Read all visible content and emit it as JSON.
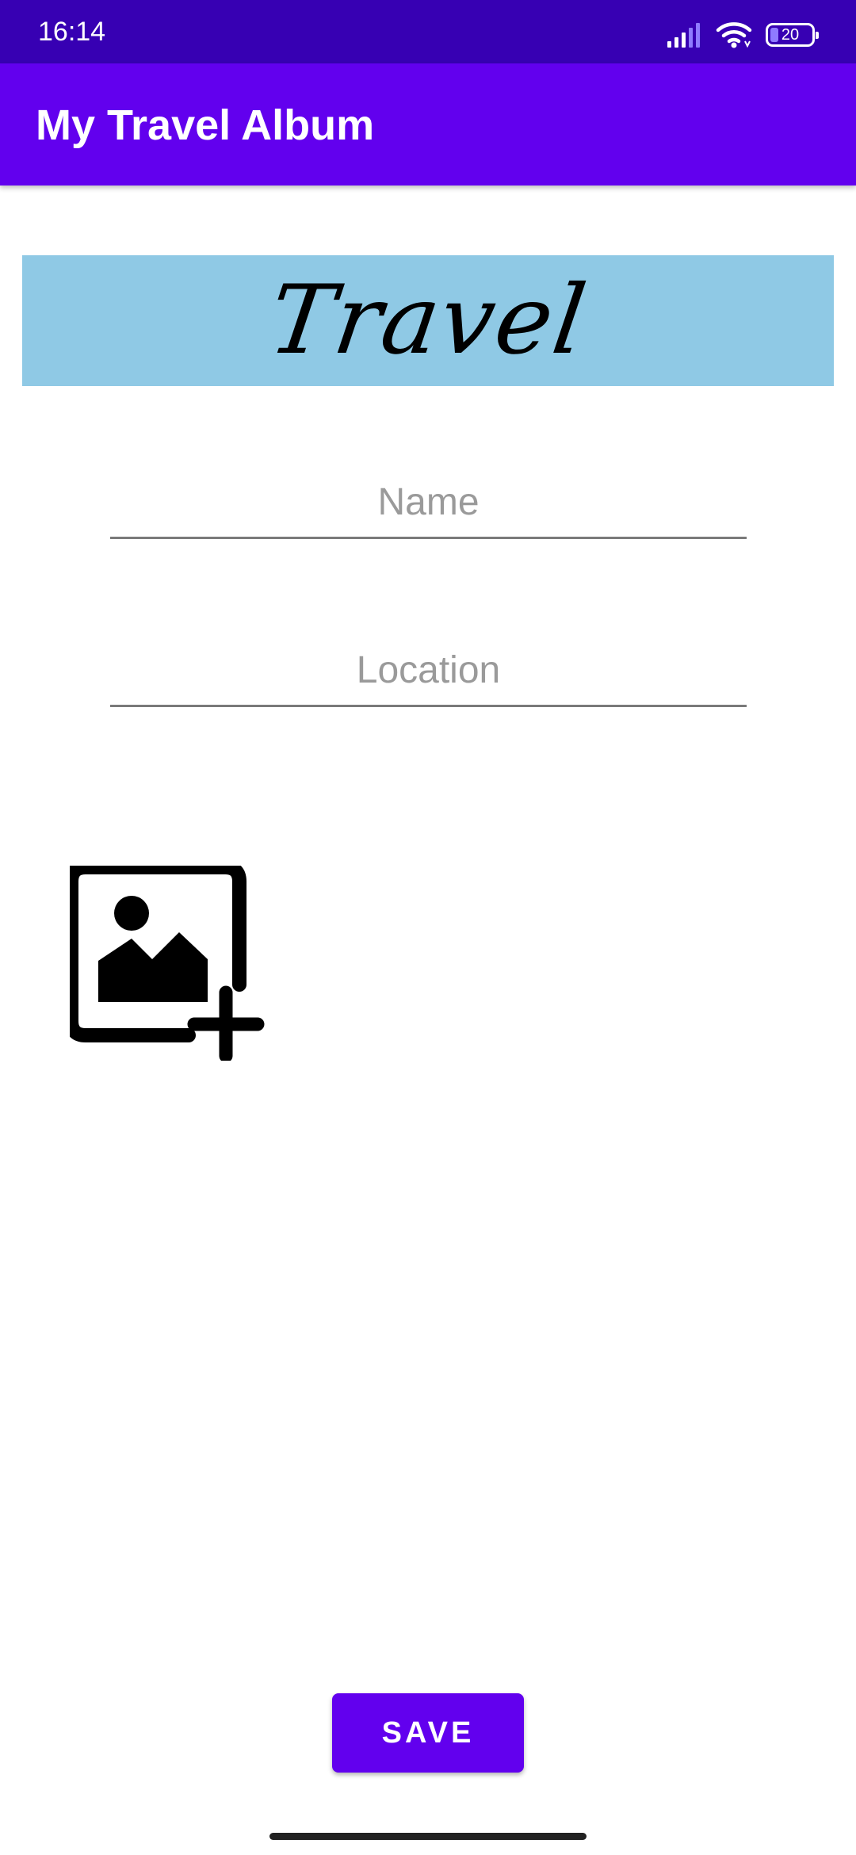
{
  "status_bar": {
    "time": "16:14",
    "battery_level": "20",
    "signal_icon": "signal-icon",
    "wifi_icon": "wifi-icon",
    "background_color": "#3700b3"
  },
  "app_bar": {
    "title": "My Travel Album",
    "background_color": "#6200ee"
  },
  "banner": {
    "text": "Travel",
    "background_color": "#8fc9e5"
  },
  "form": {
    "name_placeholder": "Name",
    "name_value": "",
    "location_placeholder": "Location",
    "location_value": ""
  },
  "add_image": {
    "icon": "add-photo-icon"
  },
  "save_button": {
    "label": "SAVE",
    "color": "#6200ee"
  }
}
